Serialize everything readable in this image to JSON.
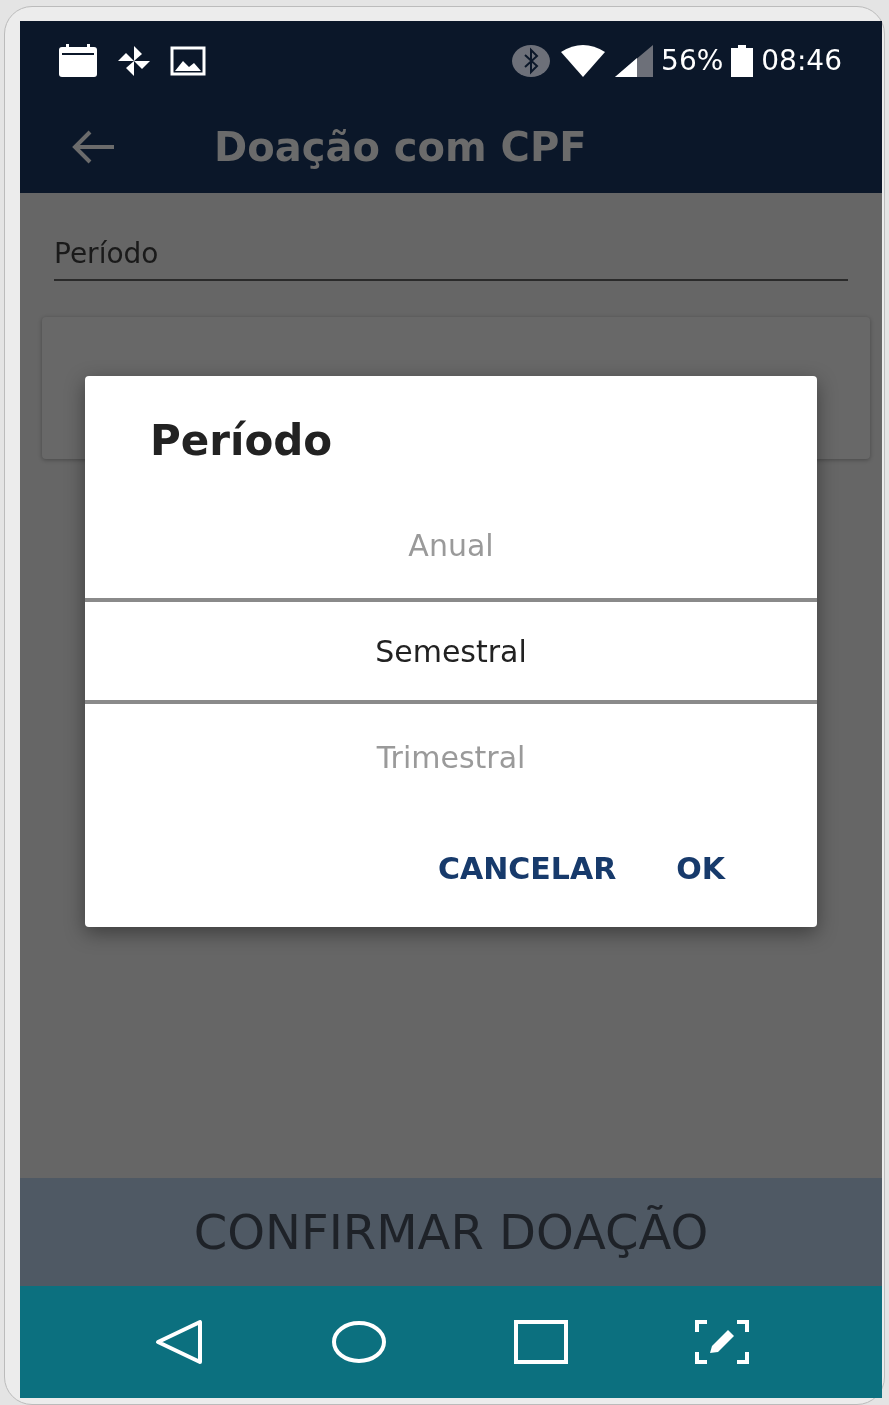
{
  "status_bar": {
    "battery": "56%",
    "time": "08:46"
  },
  "toolbar": {
    "title": "Doação com CPF"
  },
  "form": {
    "field_label": "Período"
  },
  "confirm_button": "CONFIRMAR DOAÇÃO",
  "dialog": {
    "title": "Período",
    "options": [
      {
        "label": "Anual",
        "selected": false
      },
      {
        "label": "Semestral",
        "selected": true
      },
      {
        "label": "Trimestral",
        "selected": false
      }
    ],
    "buttons": [
      "CANCELAR",
      "OK"
    ]
  }
}
